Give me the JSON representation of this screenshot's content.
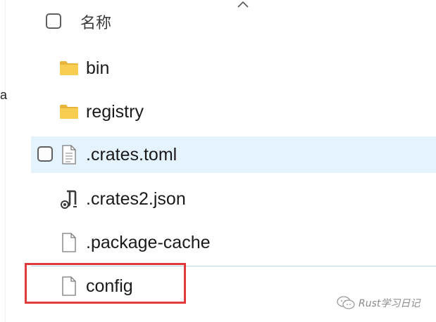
{
  "header": {
    "name_column": "名称",
    "edge_fragment": "a"
  },
  "files": [
    {
      "name": "bin",
      "type": "folder",
      "icon": "folder-icon"
    },
    {
      "name": "registry",
      "type": "folder",
      "icon": "folder-icon"
    },
    {
      "name": ".crates.toml",
      "type": "text-file",
      "icon": "text-file-icon",
      "selected": true
    },
    {
      "name": ".crates2.json",
      "type": "json-file",
      "icon": "json-file-icon"
    },
    {
      "name": ".package-cache",
      "type": "file",
      "icon": "blank-file-icon"
    },
    {
      "name": "config",
      "type": "file",
      "icon": "blank-file-icon",
      "highlighted": true
    }
  ],
  "watermark": {
    "text": "Rust学习日记",
    "icon": "wechat-icon"
  },
  "colors": {
    "selected_row": "#e5f3ff",
    "highlight_border": "#e03a3a",
    "folder": "#f4c64a"
  }
}
